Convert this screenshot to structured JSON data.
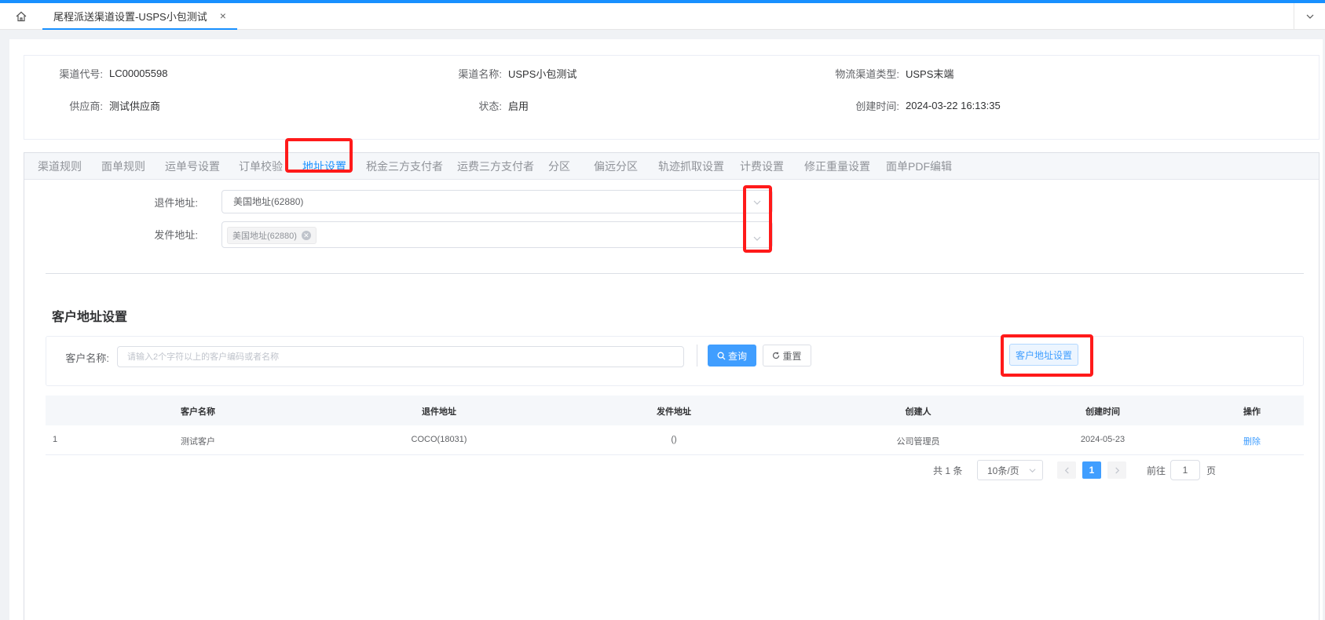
{
  "tabbar": {
    "page_tab_label": "尾程派送渠道设置-USPS小包测试",
    "close_glyph": "×"
  },
  "info": {
    "channel_code_label": "渠道代号:",
    "channel_code": "LC00005598",
    "channel_name_label": "渠道名称:",
    "channel_name": "USPS小包测试",
    "logistics_type_label": "物流渠道类型:",
    "logistics_type": "USPS末端",
    "supplier_label": "供应商:",
    "supplier": "测试供应商",
    "status_label": "状态:",
    "status": "启用",
    "created_label": "创建时间:",
    "created": "2024-03-22 16:13:35"
  },
  "tabs": [
    {
      "label": "渠道规则"
    },
    {
      "label": "面单规则"
    },
    {
      "label": "运单号设置"
    },
    {
      "label": "订单校验"
    },
    {
      "label": "地址设置"
    },
    {
      "label": "税金三方支付者"
    },
    {
      "label": "运费三方支付者"
    },
    {
      "label": "分区"
    },
    {
      "label": "偏远分区"
    },
    {
      "label": "轨迹抓取设置"
    },
    {
      "label": "计费设置"
    },
    {
      "label": "修正重量设置"
    },
    {
      "label": "面单PDF编辑"
    }
  ],
  "address_form": {
    "return_label": "退件地址:",
    "return_value": "美国地址(62880)",
    "send_label": "发件地址:",
    "send_tag": "美国地址(62880)"
  },
  "customer_section": {
    "title": "客户地址设置",
    "customer_name_label": "客户名称:",
    "customer_name_placeholder": "请输入2个字符以上的客户编码或者名称",
    "query_label": "查询",
    "reset_label": "重置",
    "customer_address_btn": "客户地址设置"
  },
  "table": {
    "headers": [
      "客户名称",
      "退件地址",
      "发件地址",
      "创建人",
      "创建时间",
      "操作"
    ],
    "rows": [
      {
        "index": "1",
        "name": "测试客户",
        "return": "COCO(18031)",
        "send": "()",
        "creator": "公司管理员",
        "created": "2024-05-23",
        "action": "删除"
      }
    ]
  },
  "pager": {
    "total": "共 1 条",
    "page_size": "10条/页",
    "current": "1",
    "goto_label": "前往",
    "goto_value": "1",
    "page_suffix": "页"
  },
  "colors": {
    "primary": "#409eff",
    "accent_bar": "#1890ff",
    "highlight": "#ff1a1a"
  }
}
